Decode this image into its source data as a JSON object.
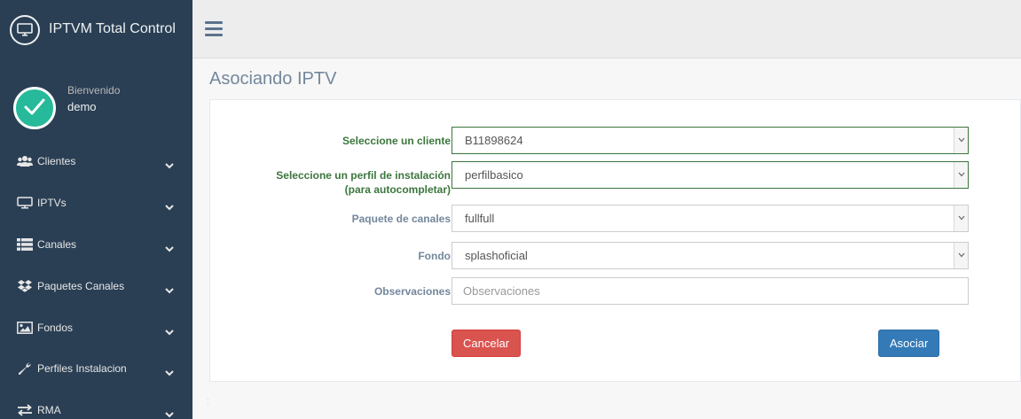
{
  "app": {
    "title": "IPTVM Total Control"
  },
  "profile": {
    "welcome": "Bienvenido",
    "username": "demo"
  },
  "sidebar": {
    "items": [
      {
        "label": "Clientes",
        "icon": "users-icon"
      },
      {
        "label": "IPTVs",
        "icon": "monitor-icon"
      },
      {
        "label": "Canales",
        "icon": "list-icon"
      },
      {
        "label": "Paquetes Canales",
        "icon": "dropbox-icon"
      },
      {
        "label": "Fondos",
        "icon": "image-icon"
      },
      {
        "label": "Perfiles Instalacion",
        "icon": "wrench-icon"
      },
      {
        "label": "RMA",
        "icon": "exchange-icon"
      }
    ]
  },
  "page": {
    "title": "Asociando IPTV"
  },
  "form": {
    "client": {
      "label": "Seleccione un cliente",
      "value": "B11898624"
    },
    "profile": {
      "label_line1": "Seleccione un perfil de instalación",
      "label_line2": "(para autocompletar)",
      "value": "perfilbasico"
    },
    "package": {
      "label": "Paquete de canales",
      "value": "fullfull"
    },
    "background": {
      "label": "Fondo",
      "value": "splashoficial"
    },
    "notes": {
      "label": "Observaciones",
      "placeholder": "Observaciones",
      "value": ""
    }
  },
  "buttons": {
    "cancel": "Cancelar",
    "submit": "Asociar"
  },
  "colors": {
    "sidebar_bg": "#2a3f54",
    "success_label": "#3c763d",
    "danger": "#d9534f",
    "primary": "#337ab7",
    "avatar": "#26b99a"
  }
}
